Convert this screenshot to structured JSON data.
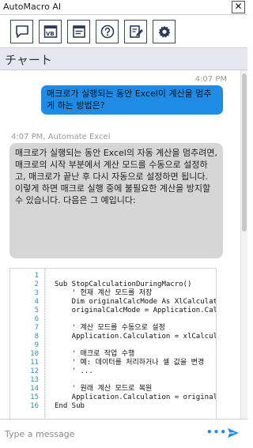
{
  "window": {
    "title": "AutoMacro AI",
    "close_glyph": "✕"
  },
  "toolbar": {
    "buttons": [
      {
        "icon": "chat-bubble-icon"
      },
      {
        "icon": "vba-module-icon"
      },
      {
        "icon": "document-icon"
      },
      {
        "icon": "help-icon"
      },
      {
        "icon": "edit-document-icon"
      },
      {
        "icon": "gear-icon"
      }
    ]
  },
  "tab": {
    "title": "チャート"
  },
  "messages": {
    "user_time": "4:07 PM",
    "user_text": "매크로가 실행되는 동안 Excel이 계산을 멈추게 하는 방법은?",
    "bot_header": "4:07 PM, Automate Excel",
    "bot_text": "매크로가 실행되는 동안 Excel의 자동 계산을 멈추려면, 매크로의 시작 부분에서 계산 모드를 수동으로 설정하고, 매크로가 끝난 후 다시 자동으로 설정하면 됩니다. 이렇게 하면 매크로 실행 중에 불필요한 계산을 방지할 수 있습니다. 다음은 그 예입니다:"
  },
  "code": {
    "lines": [
      {
        "n": "1",
        "t": ""
      },
      {
        "n": "2",
        "t": "Sub StopCalculationDuringMacro()"
      },
      {
        "n": "3",
        "t": "    ' 현재 계산 모드를 저장"
      },
      {
        "n": "4",
        "t": "    Dim originalCalcMode As XlCalculation"
      },
      {
        "n": "5",
        "t": "    originalCalcMode = Application.Calculation"
      },
      {
        "n": "6",
        "t": ""
      },
      {
        "n": "7",
        "t": "    ' 계산 모드를 수동으로 설정"
      },
      {
        "n": "8",
        "t": "    Application.Calculation = xlCalculationManual"
      },
      {
        "n": "9",
        "t": ""
      },
      {
        "n": "10",
        "t": "    ' 매크로 작업 수행"
      },
      {
        "n": "11",
        "t": "    ' 예: 데이터를 처리하거나 셀 값을 변경"
      },
      {
        "n": "12",
        "t": "    ' ..."
      },
      {
        "n": "13",
        "t": ""
      },
      {
        "n": "14",
        "t": "    ' 원래 계산 모드로 복원"
      },
      {
        "n": "15",
        "t": "    Application.Calculation = originalCalcMode"
      },
      {
        "n": "16",
        "t": "End Sub"
      }
    ]
  },
  "composer": {
    "placeholder": "Type a message",
    "more_label": "•••"
  },
  "colors": {
    "accent": "#1e8ce6",
    "user_bubble": "#1e8ce6",
    "bot_bubble": "#d6d6d6",
    "tab_bar": "#e7e7f2"
  }
}
